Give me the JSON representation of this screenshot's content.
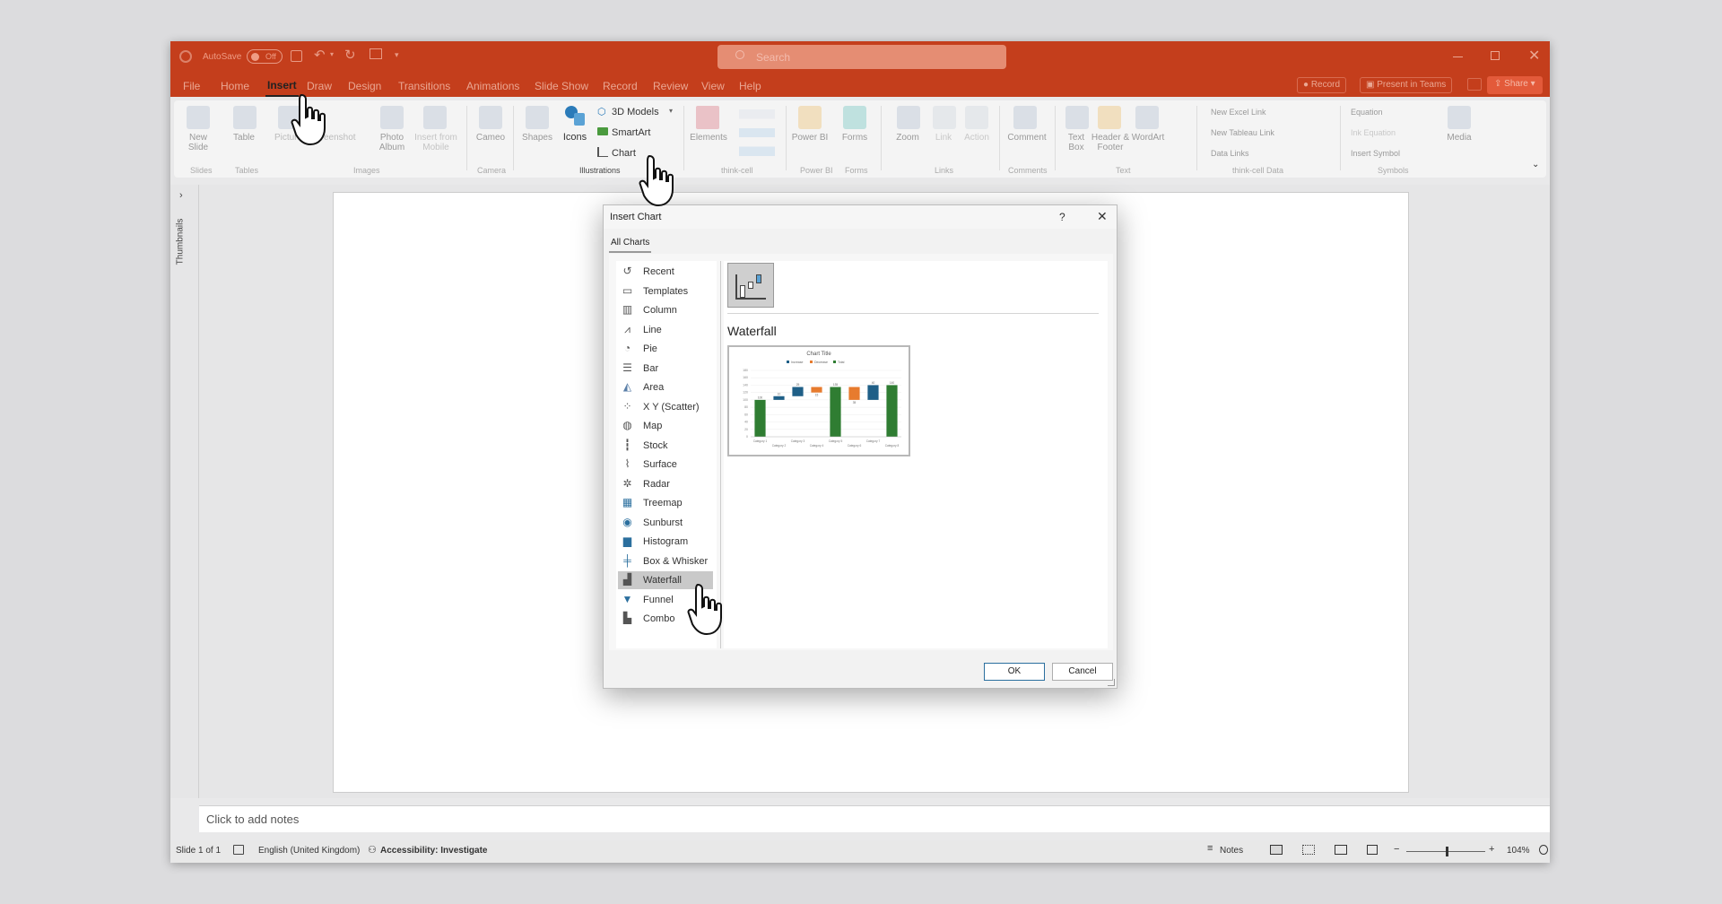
{
  "titlebar": {
    "autosave_label": "AutoSave",
    "autosave_state": "Off",
    "search_placeholder": "Search"
  },
  "tabs": [
    "File",
    "Home",
    "Insert",
    "Draw",
    "Design",
    "Transitions",
    "Animations",
    "Slide Show",
    "Record",
    "Review",
    "View",
    "Help"
  ],
  "active_tab": "Insert",
  "right_buttons": {
    "record": "Record",
    "present_teams": "Present in Teams",
    "share": "Share"
  },
  "ribbon": {
    "new_slide": "New Slide",
    "table": "Table",
    "pictures": "Pictures",
    "screenshot": "Screenshot",
    "photo_album": "Photo Album",
    "insert_from_mobile": "Insert from Mobile",
    "cameo": "Cameo",
    "shapes": "Shapes",
    "icons": "Icons",
    "models_3d": "3D Models",
    "smartart": "SmartArt",
    "chart": "Chart",
    "elements": "Elements",
    "power_bi": "Power BI",
    "forms": "Forms",
    "zoom": "Zoom",
    "link": "Link",
    "action": "Action",
    "comment": "Comment",
    "text_box": "Text Box",
    "header_footer": "Header & Footer",
    "wordart": "WordArt",
    "new_excel_link": "New Excel Link",
    "new_tableau_link": "New Tableau Link",
    "data_links": "Data Links",
    "equation": "Equation",
    "ink_equation": "Ink Equation",
    "insert_symbol": "Insert Symbol",
    "media": "Media",
    "groups": {
      "slides": "Slides",
      "tables": "Tables",
      "images": "Images",
      "camera": "Camera",
      "illustrations": "Illustrations",
      "think_cell": "think-cell",
      "power_bi": "Power BI",
      "forms": "Forms",
      "links": "Links",
      "comments": "Comments",
      "text": "Text",
      "think_cell_data": "think-cell Data",
      "symbols": "Symbols"
    }
  },
  "thumbnails_label": "Thumbnails",
  "notes_placeholder": "Click to add notes",
  "status": {
    "slide": "Slide 1 of 1",
    "language": "English (United Kingdom)",
    "accessibility": "Accessibility: Investigate",
    "notes": "Notes",
    "zoom": "104%"
  },
  "dialog": {
    "title": "Insert Chart",
    "help": "?",
    "tab": "All Charts",
    "chart_types": [
      "Recent",
      "Templates",
      "Column",
      "Line",
      "Pie",
      "Bar",
      "Area",
      "X Y (Scatter)",
      "Map",
      "Stock",
      "Surface",
      "Radar",
      "Treemap",
      "Sunburst",
      "Histogram",
      "Box & Whisker",
      "Waterfall",
      "Funnel",
      "Combo"
    ],
    "selected_type": "Waterfall",
    "subtype_heading": "Waterfall",
    "ok": "OK",
    "cancel": "Cancel",
    "preview": {
      "title": "Chart Title",
      "legend": [
        "Increase",
        "Decrease",
        "Total"
      ]
    }
  },
  "chart_data": {
    "type": "bar",
    "title": "Chart Title",
    "categories": [
      "Category 1",
      "Category 2",
      "Category 3",
      "Category 4",
      "Category 5",
      "Category 6",
      "Category 7",
      "Category 8"
    ],
    "series": [
      {
        "name": "Increase",
        "values": [
          null,
          10,
          25,
          null,
          null,
          null,
          40,
          null
        ]
      },
      {
        "name": "Decrease",
        "values": [
          null,
          null,
          null,
          15,
          null,
          35,
          null,
          null
        ]
      },
      {
        "name": "Total",
        "values": [
          100,
          null,
          null,
          null,
          135,
          null,
          null,
          140
        ]
      }
    ],
    "ylim": [
      0,
      180
    ],
    "legend_position": "top",
    "colors": {
      "increase": "#1f5f87",
      "decrease": "#e77b2e",
      "total": "#2f7d32"
    }
  },
  "colors": {
    "accent": "#c43e1c",
    "ribbon_bg": "#f4f4f4"
  }
}
